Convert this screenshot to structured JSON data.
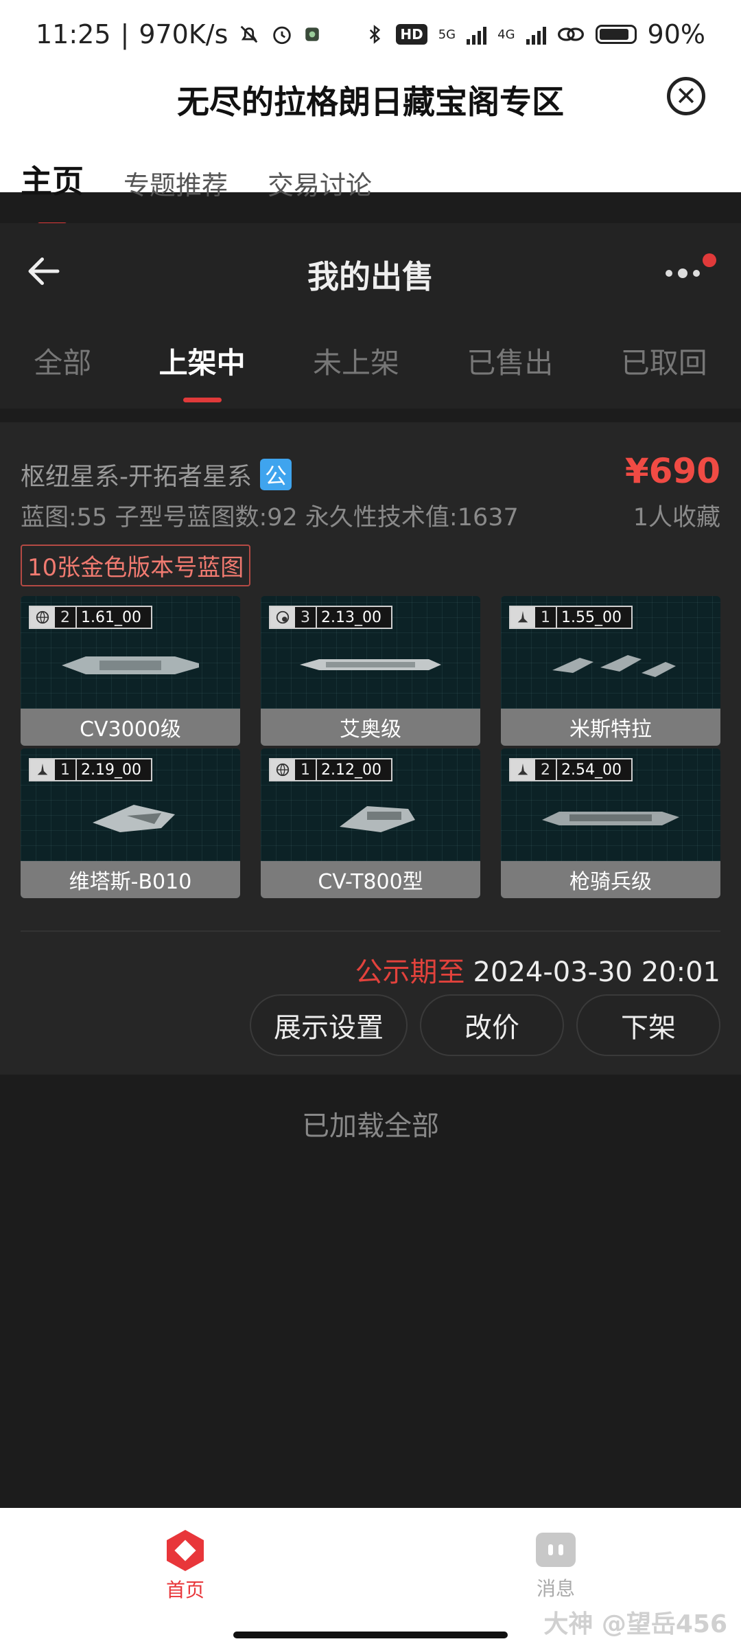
{
  "status_bar": {
    "time": "11:25",
    "speed": "970K/s",
    "hd_label": "HD",
    "net1": "5G",
    "net2": "4G",
    "battery": "90%"
  },
  "top_header": {
    "title": "无尽的拉格朗日藏宝阁专区",
    "tabs": [
      "主页",
      "专题推荐",
      "交易讨论"
    ],
    "active_tab": 0
  },
  "sub_header": {
    "title": "我的出售",
    "tabs": [
      "全部",
      "上架中",
      "未上架",
      "已售出",
      "已取回"
    ],
    "active_tab": 1
  },
  "listing": {
    "server": "枢纽星系-开拓者星系",
    "server_badge": "公",
    "price": "¥690",
    "stats": "蓝图:55 子型号蓝图数:92 永久性技术值:1637",
    "favorites": "1人收藏",
    "tag": "10张金色版本号蓝图",
    "blueprints": [
      {
        "name": "CV3000级",
        "count": "2",
        "version": "1.61_00",
        "icon": "globe-icon"
      },
      {
        "name": "艾奥级",
        "count": "3",
        "version": "2.13_00",
        "icon": "gear-globe-icon"
      },
      {
        "name": "米斯特拉",
        "count": "1",
        "version": "1.55_00",
        "icon": "fighter-icon"
      },
      {
        "name": "维塔斯-B010",
        "count": "1",
        "version": "2.19_00",
        "icon": "fighter-icon"
      },
      {
        "name": "CV-T800型",
        "count": "1",
        "version": "2.12_00",
        "icon": "globe-icon"
      },
      {
        "name": "枪骑兵级",
        "count": "2",
        "version": "2.54_00",
        "icon": "fighter-icon"
      }
    ],
    "deadline_label": "公示期至",
    "deadline_value": "2024-03-30 20:01",
    "actions": [
      "展示设置",
      "改价",
      "下架"
    ]
  },
  "footer_text": "已加载全部",
  "bottom_nav": {
    "items": [
      "首页",
      "消息"
    ],
    "active": 0
  },
  "watermark": "大神 @望岳456",
  "colors": {
    "accent": "#e03a3a",
    "price": "#f04b44",
    "badge_blue": "#3fa4ee"
  }
}
